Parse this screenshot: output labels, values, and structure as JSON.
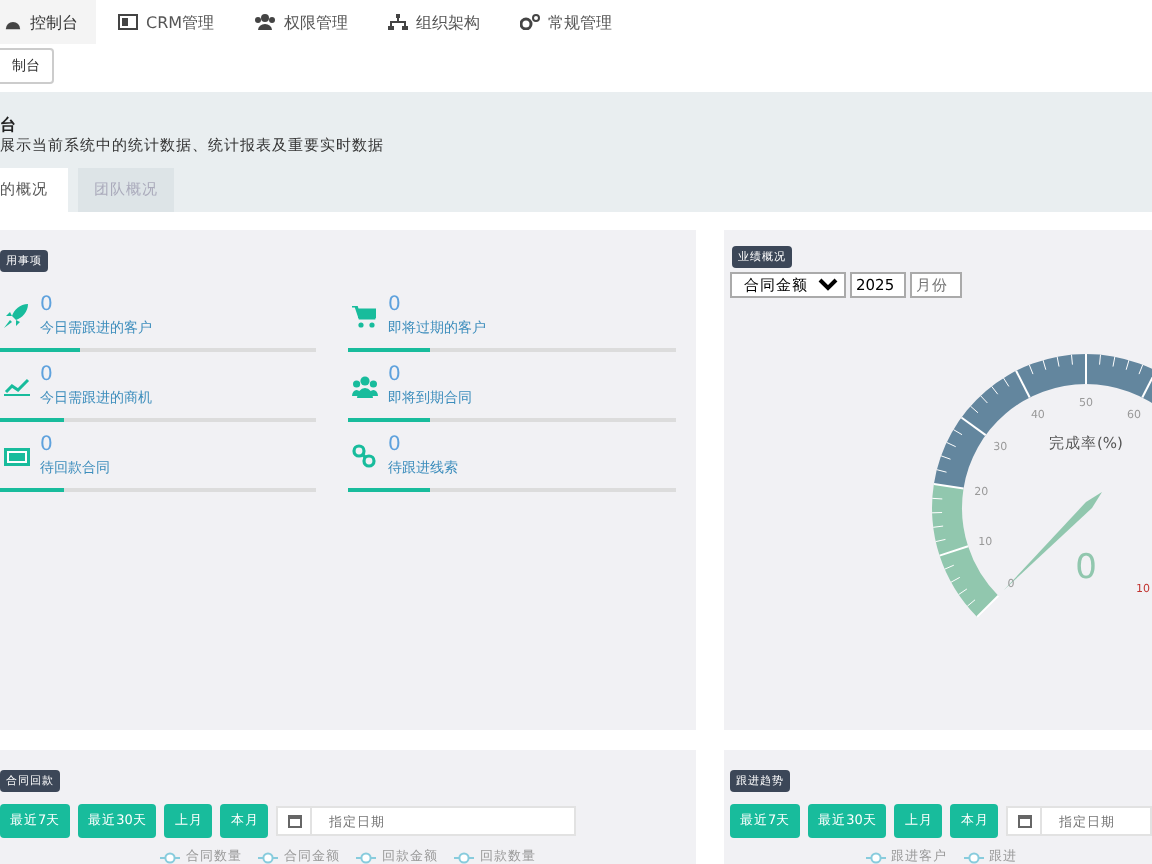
{
  "nav": {
    "items": [
      {
        "label": "控制台",
        "selected": true
      },
      {
        "label": "CRM管理",
        "selected": false
      },
      {
        "label": "权限管理",
        "selected": false
      },
      {
        "label": "组织架构",
        "selected": false
      },
      {
        "label": "常规管理",
        "selected": false
      }
    ]
  },
  "breadcrumb": {
    "button": "制台"
  },
  "header": {
    "title": "台",
    "description": "展示当前系统中的统计数据、统计报表及重要实时数据",
    "tabs": [
      {
        "label": "的概况",
        "selected": true
      },
      {
        "label": "团队概况",
        "selected": false
      }
    ]
  },
  "todo": {
    "title": "用事项",
    "items": [
      {
        "count": "0",
        "label": "今日需跟进的客户",
        "level": 0.25
      },
      {
        "count": "0",
        "label": "即将过期的客户",
        "level": 0.25
      },
      {
        "count": "0",
        "label": "今日需跟进的商机",
        "level": 0.2
      },
      {
        "count": "0",
        "label": "即将到期合同",
        "level": 0.25
      },
      {
        "count": "0",
        "label": "待回款合同",
        "level": 0.2
      },
      {
        "count": "0",
        "label": "待跟进线索",
        "level": 0.25
      }
    ]
  },
  "performance": {
    "title": "业绩概况",
    "select": "合同金额",
    "year": "2025",
    "month_placeholder": "月份",
    "gauge": {
      "title": "完成率(%)",
      "value": "0",
      "tick_labels": [
        "0",
        "10",
        "20",
        "30",
        "40",
        "50",
        "60"
      ],
      "max_label": "10"
    }
  },
  "panels": [
    {
      "title": "合同回款",
      "buttons": [
        "最近7天",
        "最近30天",
        "上月",
        "本月"
      ],
      "date_placeholder": "指定日期",
      "legend": [
        "合同数量",
        "合同金额",
        "回款金额",
        "回款数量"
      ]
    },
    {
      "title": "跟进趋势",
      "buttons": [
        "最近7天",
        "最近30天",
        "上月",
        "本月"
      ],
      "date_placeholder": "指定日期",
      "legend": [
        "跟进客户",
        "跟进"
      ]
    }
  ]
}
